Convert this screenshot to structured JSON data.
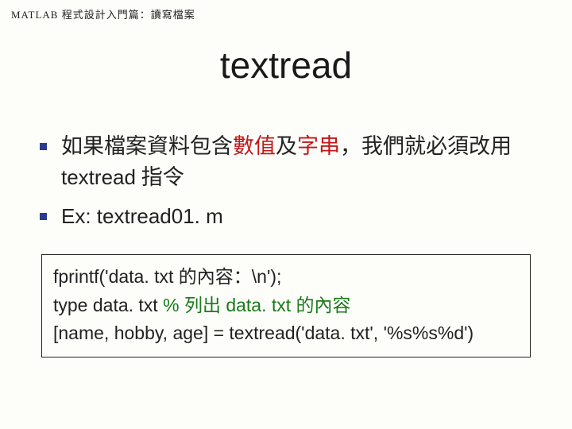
{
  "header": "MATLAB 程式設計入門篇：讀寫檔案",
  "title": "textread",
  "bullet1": {
    "part1": "如果檔案資料包含",
    "red1": "數值",
    "part2": "及",
    "red2": "字串",
    "part3": "，我們就必須改用 ",
    "latin": "textread",
    "part4": " 指令"
  },
  "bullet2": {
    "latin": "Ex: textread01. m"
  },
  "code": {
    "l1a": "fprintf('data. txt ",
    "l1zh": "的內容：",
    "l1b": "\\n');",
    "l2a": "type data. txt",
    "l2pad": "          ",
    "l2pct": "% ",
    "l2zh1": "列出",
    "l2mid": " data. txt ",
    "l2zh2": "的內容",
    "l3": "[name, hobby, age] = textread('data. txt', '%s%s%d')"
  }
}
